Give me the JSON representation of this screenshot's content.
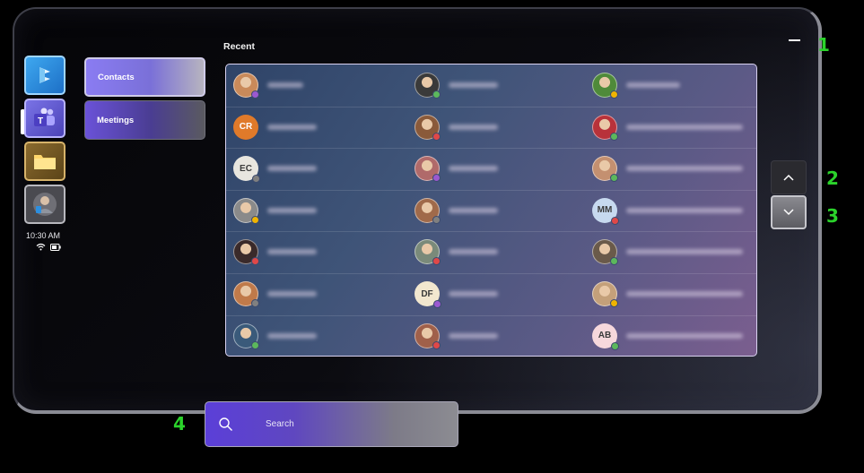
{
  "header": {
    "recent_label": "Recent"
  },
  "app_rail": {
    "apps": [
      {
        "icon": "dynamics-icon",
        "active": false
      },
      {
        "icon": "teams-icon",
        "active": true
      },
      {
        "icon": "folder-icon",
        "active": false
      },
      {
        "icon": "avatar-icon",
        "active": false
      }
    ],
    "time": "10:30 AM",
    "status_icons": [
      "wifi-icon",
      "battery-icon"
    ]
  },
  "nav": {
    "contacts_label": "Contacts",
    "meetings_label": "Meetings",
    "selected": "Contacts"
  },
  "contacts": {
    "rows": [
      [
        {
          "avatar": "photo",
          "initials": "",
          "color": "#c98a5a",
          "status": "#9b59d0"
        },
        {
          "avatar": "photo",
          "initials": "",
          "color": "#3a3a3a",
          "status": "#5cb85c"
        },
        {
          "avatar": "photo",
          "initials": "",
          "color": "#4f8a3a",
          "status": "#f0b400"
        }
      ],
      [
        {
          "avatar": "initials",
          "initials": "CR",
          "color": "#e07a2a",
          "status": ""
        },
        {
          "avatar": "photo",
          "initials": "",
          "color": "#8a5a3a",
          "status": "#e04848"
        },
        {
          "avatar": "photo",
          "initials": "",
          "color": "#b8323a",
          "status": "#5cb85c"
        }
      ],
      [
        {
          "avatar": "initials",
          "initials": "EC",
          "color": "#e8e6df",
          "status": "#808080"
        },
        {
          "avatar": "photo",
          "initials": "",
          "color": "#b06a6a",
          "status": "#9b59d0"
        },
        {
          "avatar": "photo",
          "initials": "",
          "color": "#c49070",
          "status": "#5cb85c"
        }
      ],
      [
        {
          "avatar": "photo",
          "initials": "",
          "color": "#8a8a8a",
          "status": "#f0b400"
        },
        {
          "avatar": "photo",
          "initials": "",
          "color": "#a06a4a",
          "status": "#808080"
        },
        {
          "avatar": "initials",
          "initials": "MM",
          "color": "#c7d9ef",
          "status": "#e04848"
        }
      ],
      [
        {
          "avatar": "photo",
          "initials": "",
          "color": "#3a2a2a",
          "status": "#e04848"
        },
        {
          "avatar": "photo",
          "initials": "",
          "color": "#7a8a7a",
          "status": "#e04848"
        },
        {
          "avatar": "photo",
          "initials": "",
          "color": "#6a5a4a",
          "status": "#5cb85c"
        }
      ],
      [
        {
          "avatar": "photo",
          "initials": "",
          "color": "#c07a4a",
          "status": "#808080"
        },
        {
          "avatar": "initials",
          "initials": "DF",
          "color": "#f2e7cf",
          "status": "#9b59d0"
        },
        {
          "avatar": "photo",
          "initials": "",
          "color": "#c4a07a",
          "status": "#f0b400"
        }
      ],
      [
        {
          "avatar": "photo",
          "initials": "",
          "color": "#3a5a7a",
          "status": "#5cb85c"
        },
        {
          "avatar": "photo",
          "initials": "",
          "color": "#a0604a",
          "status": "#e04848"
        },
        {
          "avatar": "initials",
          "initials": "AB",
          "color": "#f6d8dc",
          "status": "#5cb85c"
        }
      ]
    ]
  },
  "controls": {
    "minimize_icon": "minimize-icon",
    "scroll_up_icon": "chevron-up-icon",
    "scroll_down_icon": "chevron-down-icon"
  },
  "annotations": {
    "a1": "1",
    "a2": "2",
    "a3": "3",
    "a4": "4"
  },
  "search": {
    "placeholder": "Search"
  }
}
